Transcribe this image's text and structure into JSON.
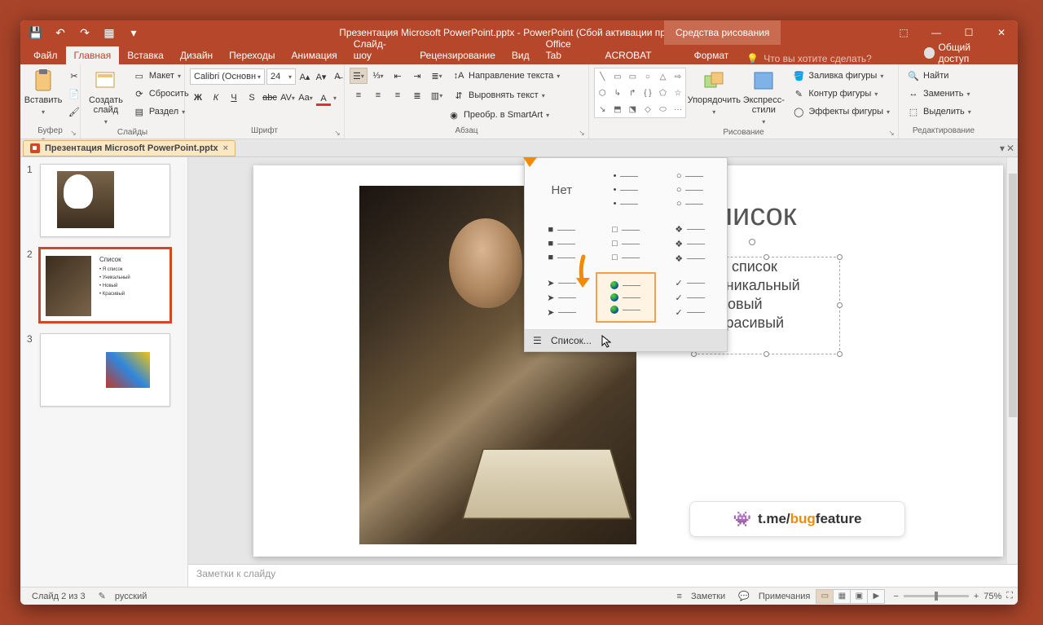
{
  "app": {
    "title_text": "Презентация Microsoft PowerPoint.pptx - PowerPoint (Сбой активации продукта)",
    "contextual_tab_group": "Средства рисования"
  },
  "tabs": {
    "file": "Файл",
    "home": "Главная",
    "insert": "Вставка",
    "design": "Дизайн",
    "transitions": "Переходы",
    "animations": "Анимация",
    "slideshow": "Слайд-шоу",
    "review": "Рецензирование",
    "view": "Вид",
    "officetab": "Office Tab",
    "acrobat": "ACROBAT",
    "format": "Формат"
  },
  "tellme": {
    "placeholder": "Что вы хотите сделать?"
  },
  "share": {
    "label": "Общий доступ"
  },
  "ribbon": {
    "clipboard": {
      "paste": "Вставить",
      "group_label": "Буфер обмена"
    },
    "slides": {
      "new_slide": "Создать слайд",
      "layout": "Макет",
      "reset": "Сбросить",
      "section": "Раздел",
      "group_label": "Слайды"
    },
    "font": {
      "name": "Calibri (Основн",
      "size": "24",
      "group_label": "Шрифт"
    },
    "paragraph": {
      "text_direction": "Направление текста",
      "align_text": "Выровнять текст",
      "smartart": "Преобр. в SmartArt",
      "group_label": "Абзац"
    },
    "drawing": {
      "arrange": "Упорядочить",
      "quick_styles": "Экспресс-стили",
      "shape_fill": "Заливка фигуры",
      "shape_outline": "Контур фигуры",
      "shape_effects": "Эффекты фигуры",
      "group_label": "Рисование"
    },
    "editing": {
      "find": "Найти",
      "replace": "Заменить",
      "select": "Выделить",
      "group_label": "Редактирование"
    }
  },
  "doctab": {
    "title": "Презентация Microsoft PowerPoint.pptx"
  },
  "slide_content": {
    "title": "Список",
    "items": [
      "Я список",
      "Уникальный",
      "Новый",
      "Красивый"
    ],
    "thumb2_title": "Список",
    "thumb2_items": [
      "Я список",
      "Уникальный",
      "Новый",
      "Красивый"
    ]
  },
  "bullet_dropdown": {
    "none_label": "Нет",
    "more_label": "Список..."
  },
  "watermark": {
    "prefix": "t.me/",
    "orange": "bug",
    "suffix": "feature"
  },
  "notes": {
    "placeholder": "Заметки к слайду"
  },
  "status": {
    "slide_counter": "Слайд 2 из 3",
    "language": "русский",
    "notes_btn": "Заметки",
    "comments_btn": "Примечания",
    "zoom_value": "75%"
  }
}
